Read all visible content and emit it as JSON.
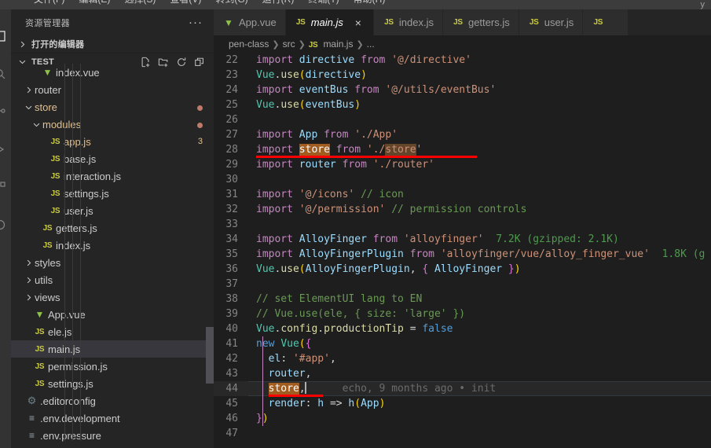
{
  "menubar": {
    "items": [
      "文件(F)",
      "编辑(E)",
      "选择(S)",
      "查看(V)",
      "转到(G)",
      "运行(R)",
      "终端(T)",
      "帮助(H)"
    ],
    "right_hint": "y"
  },
  "activitybar": {
    "items": [
      {
        "name": "explorer-icon",
        "active": true
      },
      {
        "name": "search-icon",
        "active": false
      },
      {
        "name": "source-control-icon",
        "active": false
      },
      {
        "name": "run-debug-icon",
        "active": false
      },
      {
        "name": "extensions-icon",
        "active": false
      },
      {
        "name": "test-icon",
        "active": false
      }
    ]
  },
  "sidebar": {
    "title": "资源管理器",
    "more_actions": "···",
    "open_editors": {
      "label": "打开的编辑器",
      "expanded": false
    },
    "project": {
      "label": "TEST",
      "expanded": true,
      "actions": [
        "new-file-icon",
        "new-folder-icon",
        "refresh-icon",
        "collapse-all-icon"
      ]
    },
    "tree": [
      {
        "label": "index.vue",
        "icon": "vue",
        "kind": "file",
        "depth": 3,
        "clipped": true,
        "partial_above": true
      },
      {
        "label": "router",
        "icon": "folder",
        "kind": "folder",
        "depth": 2,
        "expanded": false
      },
      {
        "label": "store",
        "icon": "folder",
        "kind": "folder",
        "depth": 2,
        "expanded": true,
        "modified": true,
        "color": "modified"
      },
      {
        "label": "modules",
        "icon": "folder",
        "kind": "folder",
        "depth": 3,
        "expanded": true,
        "modified": true,
        "color": "modified"
      },
      {
        "label": "app.js",
        "icon": "js",
        "kind": "file",
        "depth": 4,
        "badge": "3",
        "color": "modified"
      },
      {
        "label": "base.js",
        "icon": "js",
        "kind": "file",
        "depth": 4
      },
      {
        "label": "interaction.js",
        "icon": "js",
        "kind": "file",
        "depth": 4
      },
      {
        "label": "settings.js",
        "icon": "js",
        "kind": "file",
        "depth": 4
      },
      {
        "label": "user.js",
        "icon": "js",
        "kind": "file",
        "depth": 4
      },
      {
        "label": "getters.js",
        "icon": "js",
        "kind": "file",
        "depth": 3
      },
      {
        "label": "index.js",
        "icon": "js",
        "kind": "file",
        "depth": 3
      },
      {
        "label": "styles",
        "icon": "folder",
        "kind": "folder",
        "depth": 2,
        "expanded": false
      },
      {
        "label": "utils",
        "icon": "folder",
        "kind": "folder",
        "depth": 2,
        "expanded": false
      },
      {
        "label": "views",
        "icon": "folder",
        "kind": "folder",
        "depth": 2,
        "expanded": false
      },
      {
        "label": "App.vue",
        "icon": "vue",
        "kind": "file",
        "depth": 2
      },
      {
        "label": "ele.js",
        "icon": "js",
        "kind": "file",
        "depth": 2
      },
      {
        "label": "main.js",
        "icon": "js",
        "kind": "file",
        "depth": 2,
        "selected": true
      },
      {
        "label": "permission.js",
        "icon": "js",
        "kind": "file",
        "depth": 2
      },
      {
        "label": "settings.js",
        "icon": "js",
        "kind": "file",
        "depth": 2
      },
      {
        "label": ".editorconfig",
        "icon": "gear",
        "kind": "file",
        "depth": 1
      },
      {
        "label": ".env.development",
        "icon": "file",
        "kind": "file",
        "depth": 1
      },
      {
        "label": ".env.pressure",
        "icon": "file",
        "kind": "file",
        "depth": 1,
        "clipped": true
      }
    ]
  },
  "tabs": [
    {
      "label": "App.vue",
      "icon": "vue",
      "active": false,
      "dirty": false
    },
    {
      "label": "main.js",
      "icon": "js",
      "active": true,
      "preview": true,
      "close": "×"
    },
    {
      "label": "index.js",
      "icon": "js",
      "active": false
    },
    {
      "label": "getters.js",
      "icon": "js",
      "active": false
    },
    {
      "label": "user.js",
      "icon": "js",
      "active": false
    },
    {
      "label": "",
      "icon": "js",
      "active": false,
      "clipped": true
    }
  ],
  "breadcrumbs": [
    "pen-class",
    "src",
    "main.js",
    "..."
  ],
  "editor": {
    "file": "main.js",
    "first_line": 22,
    "last_line": 47,
    "cursor_line": 44,
    "blame": "echo, 9 months ago • init",
    "lines": [
      {
        "n": 22,
        "text": "import directive from '@/directive'"
      },
      {
        "n": 23,
        "text": "Vue.use(directive)"
      },
      {
        "n": 24,
        "text": "import eventBus from '@/utils/eventBus'"
      },
      {
        "n": 25,
        "text": "Vue.use(eventBus)"
      },
      {
        "n": 26,
        "text": ""
      },
      {
        "n": 27,
        "text": "import App from './App'"
      },
      {
        "n": 28,
        "text": "import store from './store'",
        "annotated": true
      },
      {
        "n": 29,
        "text": "import router from './router'"
      },
      {
        "n": 30,
        "text": ""
      },
      {
        "n": 31,
        "text": "import '@/icons' // icon"
      },
      {
        "n": 32,
        "text": "import '@/permission' // permission controls"
      },
      {
        "n": 33,
        "text": ""
      },
      {
        "n": 34,
        "text": "import AlloyFinger from 'alloyfinger'",
        "inlay": "7.2K (gzipped: 2.1K)"
      },
      {
        "n": 35,
        "text": "import AlloyFingerPlugin from 'alloyfinger/vue/alloy_finger_vue'",
        "inlay": "1.8K (g"
      },
      {
        "n": 36,
        "text": "Vue.use(AlloyFingerPlugin, { AlloyFinger })"
      },
      {
        "n": 37,
        "text": ""
      },
      {
        "n": 38,
        "text": "// set ElementUI lang to EN"
      },
      {
        "n": 39,
        "text": "// Vue.use(ele, { size: 'large' })"
      },
      {
        "n": 40,
        "text": "Vue.config.productionTip = false"
      },
      {
        "n": 41,
        "text": "new Vue({"
      },
      {
        "n": 42,
        "text": "  el: '#app',"
      },
      {
        "n": 43,
        "text": "  router,"
      },
      {
        "n": 44,
        "text": "  store,",
        "current": true,
        "annotated": true
      },
      {
        "n": 45,
        "text": "  render: h => h(App)"
      },
      {
        "n": 46,
        "text": "})"
      },
      {
        "n": 47,
        "text": ""
      }
    ],
    "highlighted_word": "store"
  },
  "colors": {
    "background": "#1e1e1e",
    "sidebar": "#252526",
    "activitybar": "#333333",
    "menubar": "#3c3c3c",
    "tab_active": "#1e1e1e",
    "tab_inactive": "#2d2d2d",
    "selection": "#37373d",
    "occurrence_highlight": "#a15c1f",
    "annotation_red": "#ff0000",
    "modified_file": "#e2c08d",
    "js_icon": "#cbcb41",
    "vue_icon": "#8dc149"
  }
}
